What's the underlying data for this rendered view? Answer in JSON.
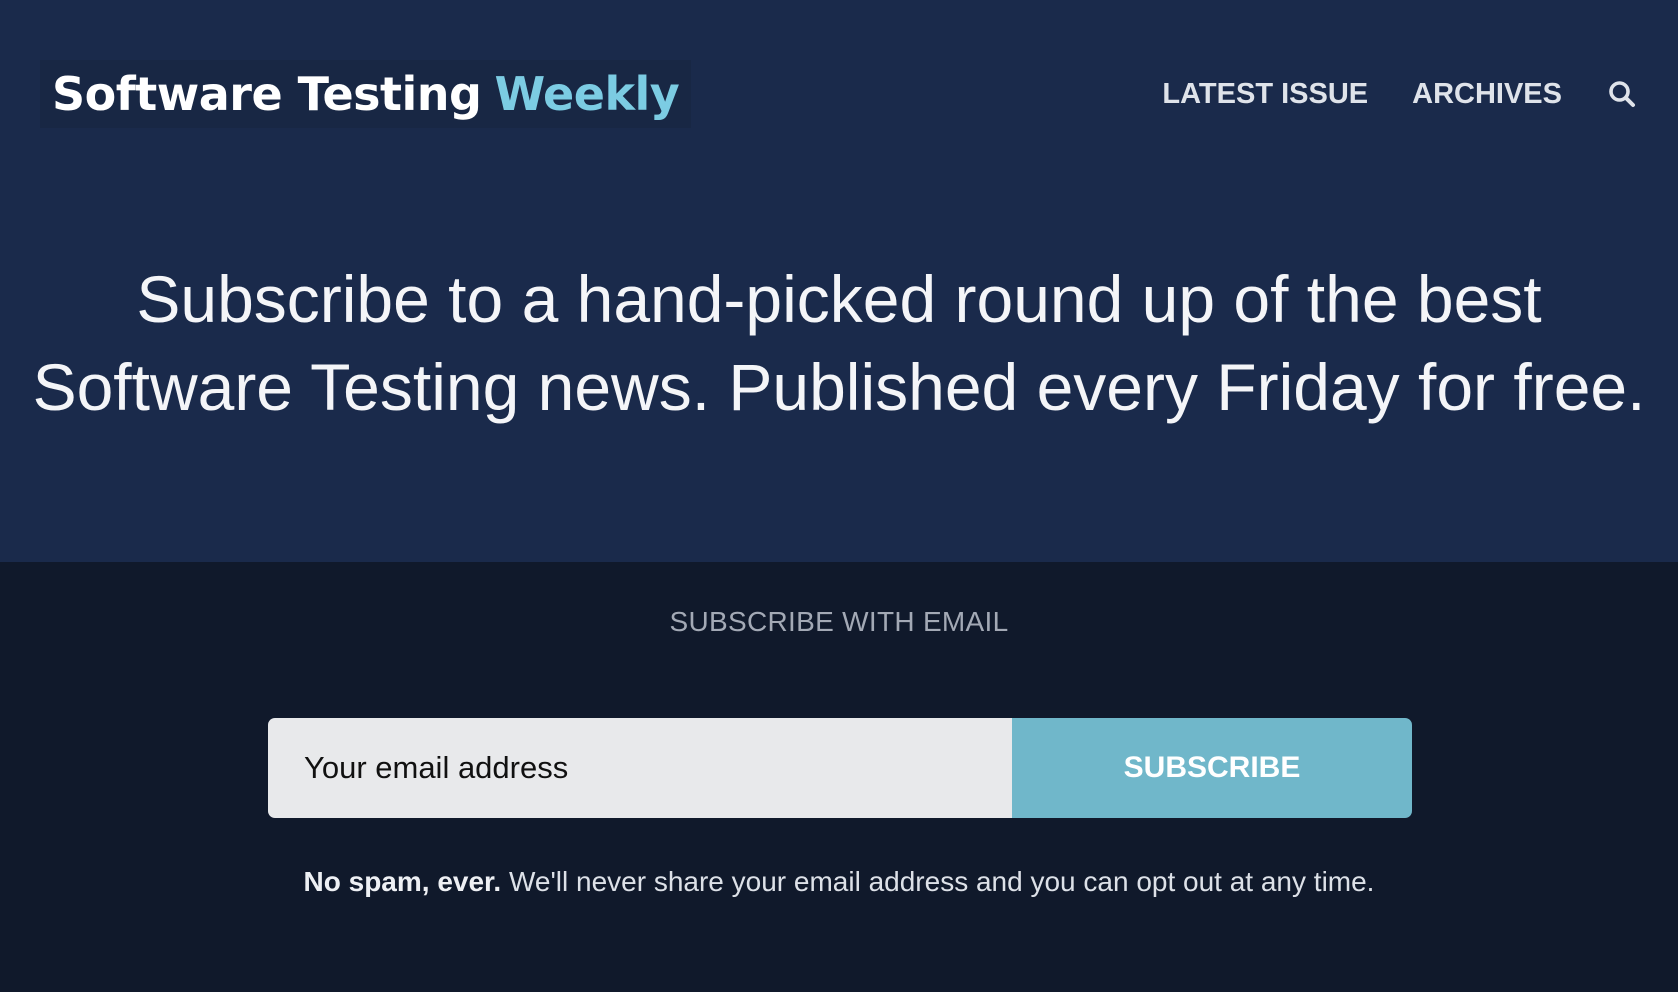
{
  "header": {
    "logo_main": "Software Testing",
    "logo_accent": "Weekly",
    "nav": [
      {
        "label": "LATEST ISSUE"
      },
      {
        "label": "ARCHIVES"
      }
    ],
    "search_icon": "search-icon"
  },
  "hero": {
    "headline_line1": "Subscribe to a hand-picked round up of the best",
    "headline_line2": "Software Testing news. Published every Friday for free."
  },
  "subscribe": {
    "heading": "SUBSCRIBE WITH EMAIL",
    "email_value": "",
    "email_placeholder": "Your email address",
    "button_label": "SUBSCRIBE",
    "disclaimer_bold": "No spam, ever.",
    "disclaimer_rest": " We'll never share your email address and you can opt out at any time."
  },
  "colors": {
    "hero_bg": "#1a2a4b",
    "subscribe_bg": "#10192b",
    "accent": "#7ccce3",
    "button_bg": "#70b7ca"
  }
}
